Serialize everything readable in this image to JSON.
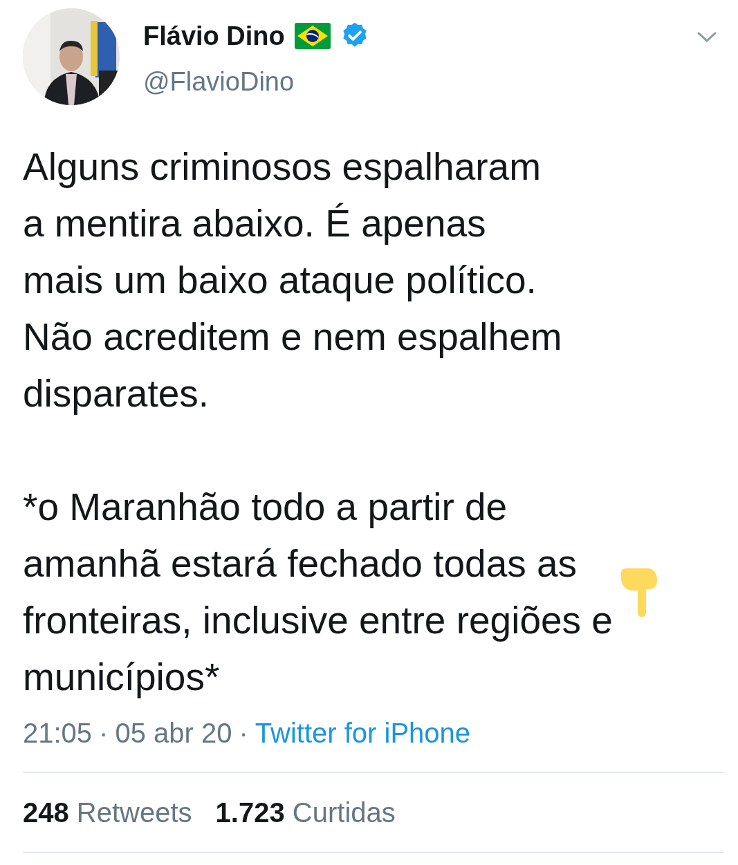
{
  "author": {
    "name": "Flávio Dino",
    "handle": "@FlavioDino",
    "verified": true
  },
  "tweet": {
    "paragraphs": [
      [
        "Alguns criminosos espalharam",
        "a mentira abaixo. É apenas",
        "mais um baixo ataque político.",
        "Não acreditem e nem espalhem",
        "disparates."
      ],
      [
        "*o Maranhão todo a partir de",
        "amanhã estará fechado todas as",
        "fronteiras, inclusive entre regiões e",
        "municípios*"
      ]
    ],
    "time": "21:05",
    "separator": "·",
    "date": "05 abr 20",
    "source": "Twitter for iPhone"
  },
  "stats": [
    {
      "text": "**248** Retweets"
    },
    {
      "text": "**1.723** Curtidas"
    }
  ]
}
